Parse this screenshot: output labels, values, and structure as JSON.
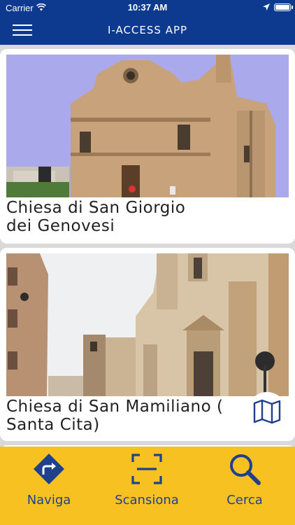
{
  "status_bar": {
    "carrier": "Carrier",
    "time": "10:37 AM"
  },
  "header": {
    "title": "I-ACCESS APP",
    "menu_icon": "hamburger-menu-icon"
  },
  "cards": [
    {
      "title_line1": "Chiesa di San Giorgio",
      "title_line2": "dei Genovesi"
    },
    {
      "title_line1": "Chiesa di San Mamiliano (",
      "title_line2": "Santa Cita)"
    }
  ],
  "map_button": {
    "icon": "map-icon"
  },
  "tab_bar": {
    "tabs": [
      {
        "label": "Naviga",
        "icon": "navigate-sign-icon"
      },
      {
        "label": "Scansiona",
        "icon": "scan-frame-icon"
      },
      {
        "label": "Cerca",
        "icon": "search-icon"
      }
    ]
  },
  "colors": {
    "header_bg": "#0d3a8f",
    "tab_bar_bg": "#f7c221",
    "tab_fg": "#1f3f8f"
  }
}
